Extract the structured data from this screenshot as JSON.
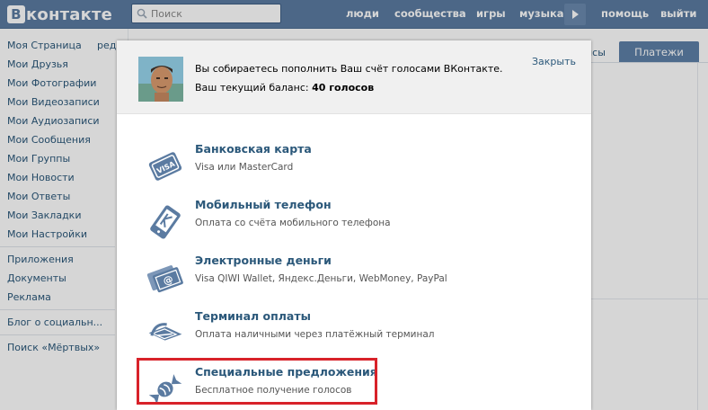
{
  "header": {
    "logo_text": "контакте",
    "logo_letter": "В",
    "search_placeholder": "Поиск",
    "nav": [
      "люди",
      "сообщества",
      "игры",
      "музыка",
      "помощь",
      "выйти"
    ],
    "brand_color": "#5b7ba1"
  },
  "sidebar": {
    "edit_label": "ред",
    "items": [
      "Моя Страница",
      "Мои Друзья",
      "Мои Фотографии",
      "Мои Видеозаписи",
      "Мои Аудиозаписи",
      "Мои Сообщения",
      "Мои Группы",
      "Мои Новости",
      "Мои Ответы",
      "Мои Закладки",
      "Мои Настройки"
    ],
    "items2": [
      "Приложения",
      "Документы",
      "Реклама"
    ],
    "items3": [
      "Блог о социальн..."
    ],
    "items4": [
      "Поиск «Мёртвых»"
    ]
  },
  "background_tabs": {
    "inactive": "исы",
    "active": "Платежи"
  },
  "modal": {
    "line1": "Вы собираетесь пополнить Ваш счёт голосами ВКонтакте.",
    "balance_label": "Ваш текущий баланс: ",
    "balance_value": "40 голосов",
    "close_label": "Закрыть",
    "options": [
      {
        "title": "Банковская карта",
        "subtitle": "Visa или MasterCard",
        "icon": "visa-card-icon"
      },
      {
        "title": "Мобильный телефон",
        "subtitle": "Оплата со счёта мобильного телефона",
        "icon": "mobile-phone-icon"
      },
      {
        "title": "Электронные деньги",
        "subtitle": "Visa QIWI Wallet, Яндекс.Деньги, WebMoney, PayPal",
        "icon": "e-money-icon"
      },
      {
        "title": "Терминал оплаты",
        "subtitle": "Оплата наличными через платёжный терминал",
        "icon": "payment-terminal-icon"
      },
      {
        "title": "Специальные предложения",
        "subtitle": "Бесплатное получение голосов",
        "icon": "candy-icon"
      }
    ],
    "highlight_color": "#d8222a"
  }
}
